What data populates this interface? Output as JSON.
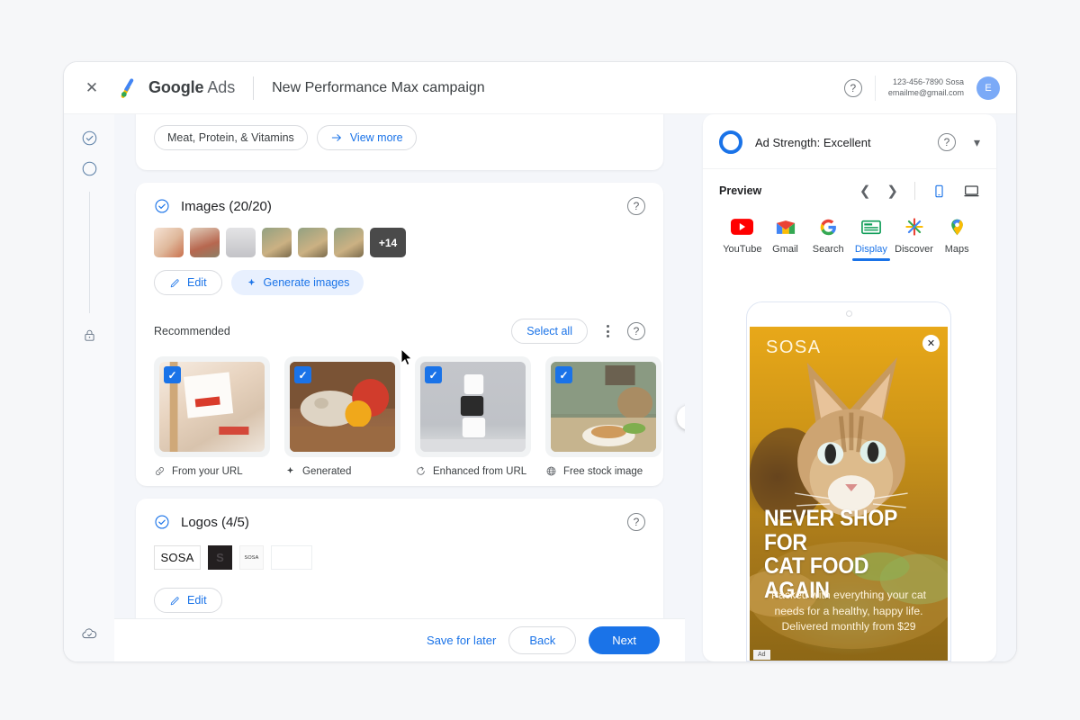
{
  "topbar": {
    "close_icon": "close-icon",
    "brand_google": "Google",
    "brand_ads": "Ads",
    "campaign_title": "New Performance Max campaign",
    "help_icon": "help-icon",
    "account_phone": "123-456-7890 Sosa",
    "account_email": "emailme@gmail.com",
    "avatar_initial": "E"
  },
  "rail": {
    "items": [
      {
        "name": "step-complete-icon"
      },
      {
        "name": "step-current-icon"
      },
      {
        "name": "lock-icon"
      },
      {
        "name": "cloud-done-icon"
      }
    ]
  },
  "top_card": {
    "chip_label": "Meat, Protein, & Vitamins",
    "view_more_label": "View more"
  },
  "images_section": {
    "title": "Images (20/20)",
    "status_icon": "check-circle-icon",
    "help_icon": "help-icon",
    "more_count": "+14",
    "edit_label": "Edit",
    "edit_icon": "pencil-icon",
    "generate_label": "Generate images",
    "generate_icon": "sparkle-icon",
    "thumbnails": [
      {
        "name": "thumb-1",
        "colors": [
          "#f3ddd1",
          "#e8c3a8"
        ]
      },
      {
        "name": "thumb-2",
        "colors": [
          "#d9c3ad",
          "#b8694f"
        ]
      },
      {
        "name": "thumb-3",
        "colors": [
          "#d8d8da",
          "#bfbfc3"
        ]
      },
      {
        "name": "thumb-4",
        "colors": [
          "#8d9a7e",
          "#c0ab85"
        ]
      },
      {
        "name": "thumb-5",
        "colors": [
          "#8d9a7e",
          "#c0ab85"
        ]
      },
      {
        "name": "thumb-6",
        "colors": [
          "#8d9a7e",
          "#c0ab85"
        ]
      }
    ]
  },
  "recommended": {
    "label": "Recommended",
    "select_all_label": "Select all",
    "kebab_icon": "more-vert-icon",
    "help_icon": "help-icon",
    "next_arrow_icon": "chevron-right-icon",
    "cards": [
      {
        "caption": "From your URL",
        "icon": "link-icon",
        "checked": true
      },
      {
        "caption": "Generated",
        "icon": "sparkle-icon",
        "checked": true
      },
      {
        "caption": "Enhanced from URL",
        "icon": "enhance-icon",
        "checked": true
      },
      {
        "caption": "Free stock image",
        "icon": "globe-icon",
        "checked": true
      }
    ]
  },
  "logos_section": {
    "title": "Logos (4/5)",
    "status_icon": "check-circle-icon",
    "help_icon": "help-icon",
    "edit_label": "Edit",
    "logos": [
      {
        "name": "logo-wordmark-light",
        "text": "SOSA"
      },
      {
        "name": "logo-square-dark",
        "text": "S"
      },
      {
        "name": "logo-small",
        "text": "SOSA"
      },
      {
        "name": "logo-blank",
        "text": ""
      }
    ]
  },
  "footer": {
    "save_for_later": "Save for later",
    "back_label": "Back",
    "next_label": "Next"
  },
  "preview": {
    "ad_strength_label": "Ad Strength: Excellent",
    "strength_icon": "strength-ring-icon",
    "help_icon": "help-icon",
    "collapse_icon": "chevron-down-icon",
    "preview_label": "Preview",
    "prev_icon": "chevron-left-icon",
    "next_icon": "chevron-right-icon",
    "mobile_icon": "mobile-device-icon",
    "desktop_icon": "desktop-device-icon",
    "channels": [
      {
        "label": "YouTube",
        "icon": "youtube-icon",
        "active": false
      },
      {
        "label": "Gmail",
        "icon": "gmail-icon",
        "active": false
      },
      {
        "label": "Search",
        "icon": "google-g-icon",
        "active": false
      },
      {
        "label": "Display",
        "icon": "display-icon",
        "active": true
      },
      {
        "label": "Discover",
        "icon": "discover-icon",
        "active": false
      },
      {
        "label": "Maps",
        "icon": "maps-pin-icon",
        "active": false
      }
    ],
    "ad": {
      "brand": "SOSA",
      "headline_line1": "NEVER SHOP FOR",
      "headline_line2": "CAT FOOD AGAIN",
      "description": "Packed with everything your cat needs for a healthy, happy life. Delivered monthly from $29",
      "close_icon": "close-icon",
      "ad_badge": "Ad"
    }
  },
  "colors": {
    "accent_blue": "#1a73e8",
    "tonal_blue": "#e8f0fe",
    "page_bg": "#f6f7f9",
    "panel_bg": "#f4f6fa",
    "ad_gold": "#d79b14"
  }
}
